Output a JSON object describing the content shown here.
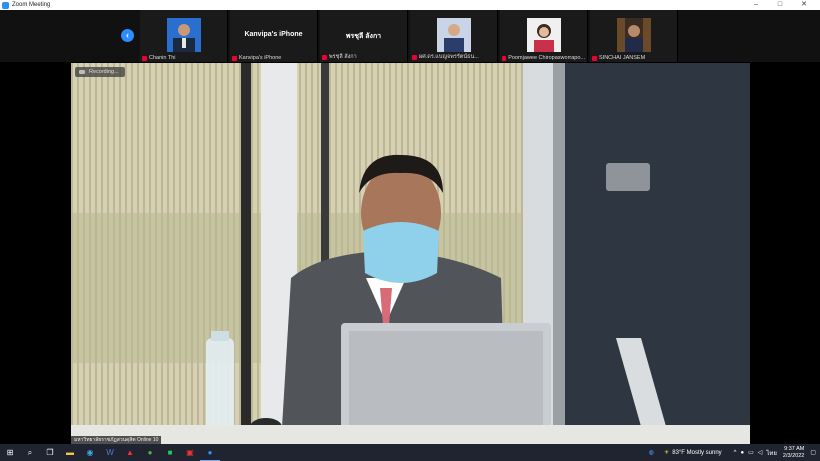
{
  "window": {
    "title": "Zoom Meeting",
    "minimize": "–",
    "maximize": "□",
    "close": "✕"
  },
  "strip": {
    "participants": [
      {
        "name": "Chanin Thi",
        "kind": "photo"
      },
      {
        "name": "Kanvipa's iPhone",
        "kind": "text",
        "display": "Kanvipa's iPhone"
      },
      {
        "name": "พรชุลี ลังกา",
        "kind": "text",
        "display": "พรชุลี ลังกา"
      },
      {
        "name": "ผศ.ดร.แบญจพรรัตน์ธน...",
        "kind": "photo"
      },
      {
        "name": "Poomjawee Chiropasworrapo...",
        "kind": "photo"
      },
      {
        "name": "SINCHAI JANSEM",
        "kind": "photo"
      }
    ]
  },
  "main_video": {
    "recording_label": "Recording...",
    "speaker_label": "มหาวิทยาลัยราชภัฏสวนดุสิต Online 10"
  },
  "taskbar": {
    "weather": "83°F  Mostly sunny",
    "time": "9:37 AM",
    "date": "2/3/2022",
    "language": "ไทย"
  },
  "colors": {
    "accent": "#2d8cff",
    "mic_off": "#e0002a"
  }
}
